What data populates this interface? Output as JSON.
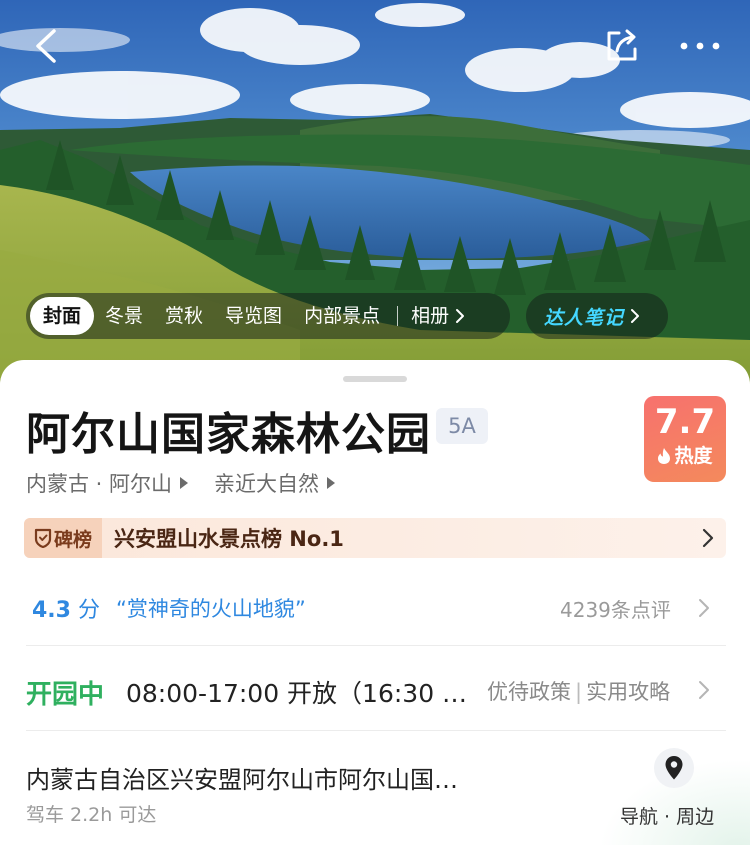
{
  "hero": {
    "icons": {
      "back": "chevron-left-icon",
      "share": "share-icon",
      "more": "more-dots-icon"
    },
    "tabs": [
      "封面",
      "冬景",
      "赏秋",
      "导览图",
      "内部景点"
    ],
    "active_tab": "封面",
    "album_label": "相册",
    "notes_label": "达人笔记"
  },
  "poi": {
    "name": "阿尔山国家森林公园",
    "level_badge": "5A",
    "heat": {
      "score": "7.7",
      "label": "热度"
    },
    "breadcrumb": {
      "region": "内蒙古 · 阿尔山",
      "theme": "亲近大自然"
    },
    "rank": {
      "tag": "碑榜",
      "text": "兴安盟山水景点榜 No.1"
    },
    "review": {
      "score": "4.3",
      "unit": "分",
      "quote": "“赏神奇的火山地貌”",
      "count": "4239条点评"
    },
    "hours": {
      "status": "开园中",
      "text": "08:00-17:00 开放（16:30 …",
      "policy": "优待政策",
      "guide": "实用攻略"
    },
    "address": {
      "text": "内蒙古自治区兴安盟阿尔山市阿尔山国…",
      "drive": "驾车 2.2h 可达",
      "nav": "导航 · 周边"
    }
  },
  "colors": {
    "accent_blue": "#2f88e0",
    "open_green": "#2fb05f",
    "heat_red": "#f7716e",
    "notes_cyan": "#44d7ff"
  }
}
